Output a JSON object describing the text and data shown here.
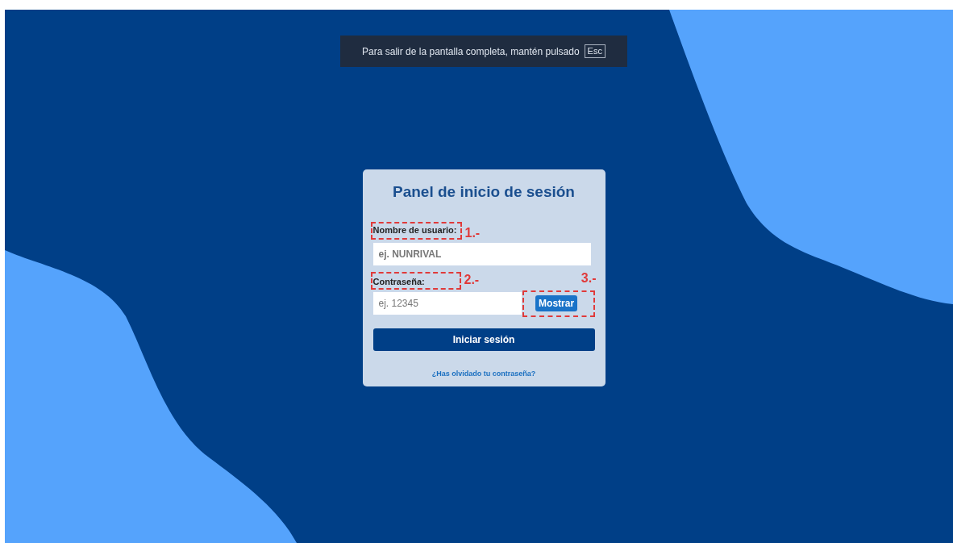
{
  "fullscreen_notice": {
    "text": "Para salir de la pantalla completa, mantén pulsado",
    "key": "Esc"
  },
  "login_panel": {
    "title": "Panel de inicio de sesión",
    "fields": [
      {
        "kind": "text",
        "label": "Nombre de usuario:",
        "placeholder": "ej. NUNRIVAL",
        "marker": "1.-"
      },
      {
        "kind": "password",
        "label": "Contraseña:",
        "placeholder": "ej. 12345",
        "marker": "2.-",
        "toggle": {
          "label": "Mostrar",
          "marker": "3.-"
        }
      }
    ],
    "submit": "Iniciar sesión",
    "forgot_link": "¿Has olvidado tu contraseña?"
  }
}
